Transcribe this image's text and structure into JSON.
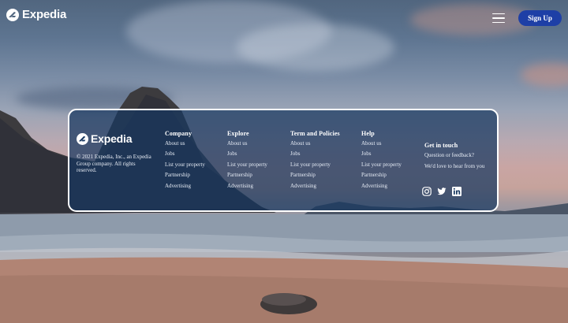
{
  "header": {
    "logo_text": "Expedia",
    "signup_label": "Sign Up"
  },
  "footer": {
    "brand": {
      "logo_text": "Expedia",
      "copyright": "© 2021 Expedia, Inc., an Expedia Group company. All rights reserved."
    },
    "columns": [
      {
        "heading": "Company",
        "links": [
          "About us",
          "Jobs",
          "List your property",
          "Partnership",
          "Advertising"
        ]
      },
      {
        "heading": "Explore",
        "links": [
          "About us",
          "Jobs",
          "List your property",
          "Partnership",
          "Advertising"
        ]
      },
      {
        "heading": "Term and Policies",
        "links": [
          "About us",
          "Jobs",
          "List your property",
          "Partnership",
          "Advertising"
        ]
      },
      {
        "heading": "Help",
        "links": [
          "About us",
          "Jobs",
          "List your property",
          "Partnership",
          "Advertising"
        ]
      }
    ],
    "contact": {
      "heading": "Get in touch",
      "lines": [
        "Question or feedback?",
        "We'd love to hear from you"
      ]
    },
    "socials": [
      "instagram-icon",
      "twitter-icon",
      "linkedin-icon"
    ]
  },
  "colors": {
    "signup_bg": "#1e3fa6",
    "card_bg": "#183860",
    "text": "#ffffff"
  }
}
